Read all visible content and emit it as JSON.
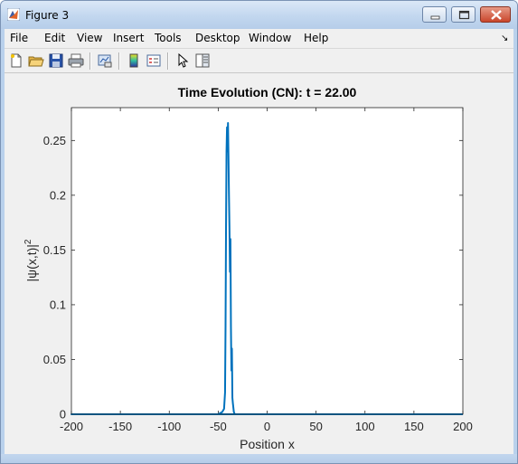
{
  "window": {
    "title": "Figure 3"
  },
  "menu": [
    "File",
    "Edit",
    "View",
    "Insert",
    "Tools",
    "Desktop",
    "Window",
    "Help"
  ],
  "toolbar": {
    "icons": [
      "new-figure-icon",
      "open-file-icon",
      "save-icon",
      "print-icon",
      "link-plot-icon",
      "colorbar-icon",
      "legend-icon",
      "pointer-icon",
      "property-editor-icon"
    ]
  },
  "chart_data": {
    "type": "line",
    "title": "Time Evolution (CN): t = 22.00",
    "xlabel": "Position x",
    "ylabel_main": "|ψ(x,t)|",
    "ylabel_exp": "2",
    "xlim": [
      -200,
      200
    ],
    "ylim": [
      0,
      0.28
    ],
    "xticks": [
      -200,
      -150,
      -100,
      -50,
      0,
      50,
      100,
      150,
      200
    ],
    "yticks": [
      0,
      0.05,
      0.1,
      0.15,
      0.2,
      0.25
    ],
    "ytick_labels": [
      "0",
      "0.05",
      "0.1",
      "0.15",
      "0.2",
      "0.25"
    ],
    "line_color": "#0072bd",
    "series": [
      {
        "x": [
          -200,
          -50,
          -46,
          -44,
          -43,
          -42.5,
          -42,
          -41.5,
          -41,
          -40.5,
          -40,
          -39.5,
          -39,
          -38.5,
          -38,
          -37.5,
          -37,
          -36.5,
          -36,
          -35.5,
          -35,
          -34,
          -33,
          -200,
          200
        ],
        "y": [
          0,
          0,
          0.002,
          0.005,
          0.02,
          0.08,
          0.17,
          0.24,
          0.262,
          0.24,
          0.266,
          0.235,
          0.2,
          0.17,
          0.13,
          0.16,
          0.08,
          0.04,
          0.06,
          0.015,
          0.01,
          0.002,
          0,
          0,
          0
        ]
      }
    ]
  }
}
